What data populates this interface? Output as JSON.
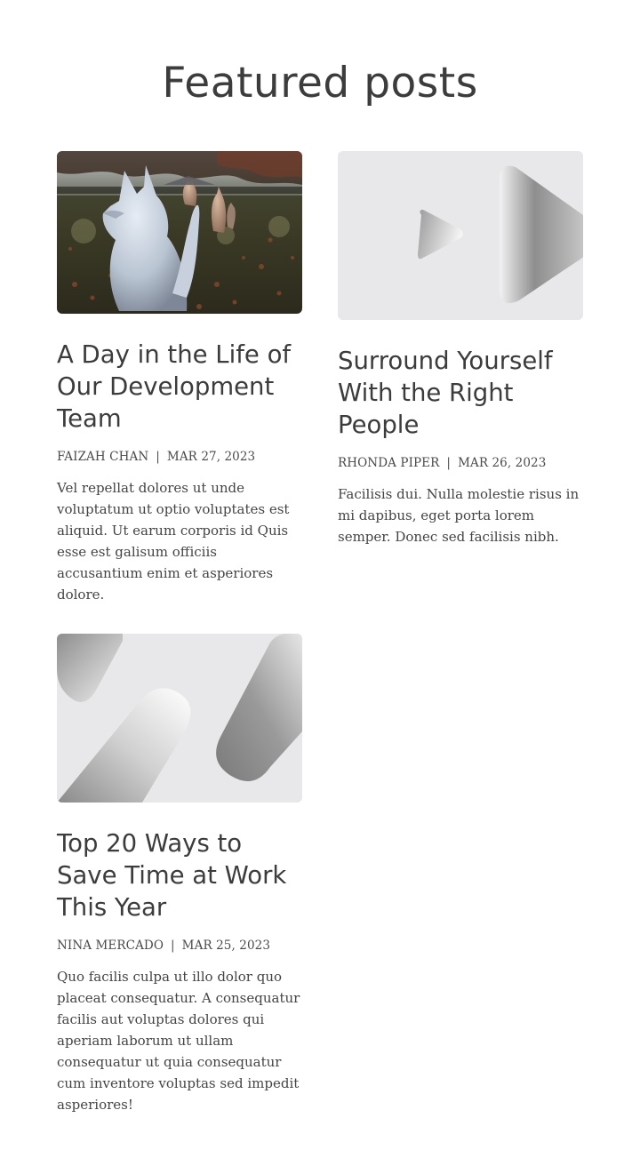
{
  "section": {
    "title": "Featured posts"
  },
  "posts": [
    {
      "title": "A Day in the Life of Our Development Team",
      "author": "FAIZAH CHAN",
      "date": "MAR 27, 2023",
      "separator": "|",
      "excerpt": "Vel repellat dolores ut unde voluptatum ut optio voluptates est aliquid. Ut earum corporis id Quis esse est galisum officiis accusantium enim et asperiores dolore.",
      "image": "photo of white fox statues in a garden"
    },
    {
      "title": "Surround Yourself With the Right People",
      "author": "RHONDA PIPER",
      "date": "MAR 26, 2023",
      "separator": "|",
      "excerpt": "Facilisis dui. Nulla molestie risus in mi dapibus, eget porta lorem semper. Donec sed facilisis nibh.",
      "image": "play-triangles-placeholder"
    },
    {
      "title": "Top 20 Ways to Save Time at Work This Year",
      "author": "NINA MERCADO",
      "date": "MAR 25, 2023",
      "separator": "|",
      "excerpt": "Quo facilis culpa ut illo dolor quo placeat consequatur. A consequatur facilis aut voluptas dolores qui aperiam laborum ut ullam consequatur ut quia consequatur cum inventore voluptas sed impedit asperiores!",
      "image": "diagonal-pills-placeholder"
    }
  ]
}
